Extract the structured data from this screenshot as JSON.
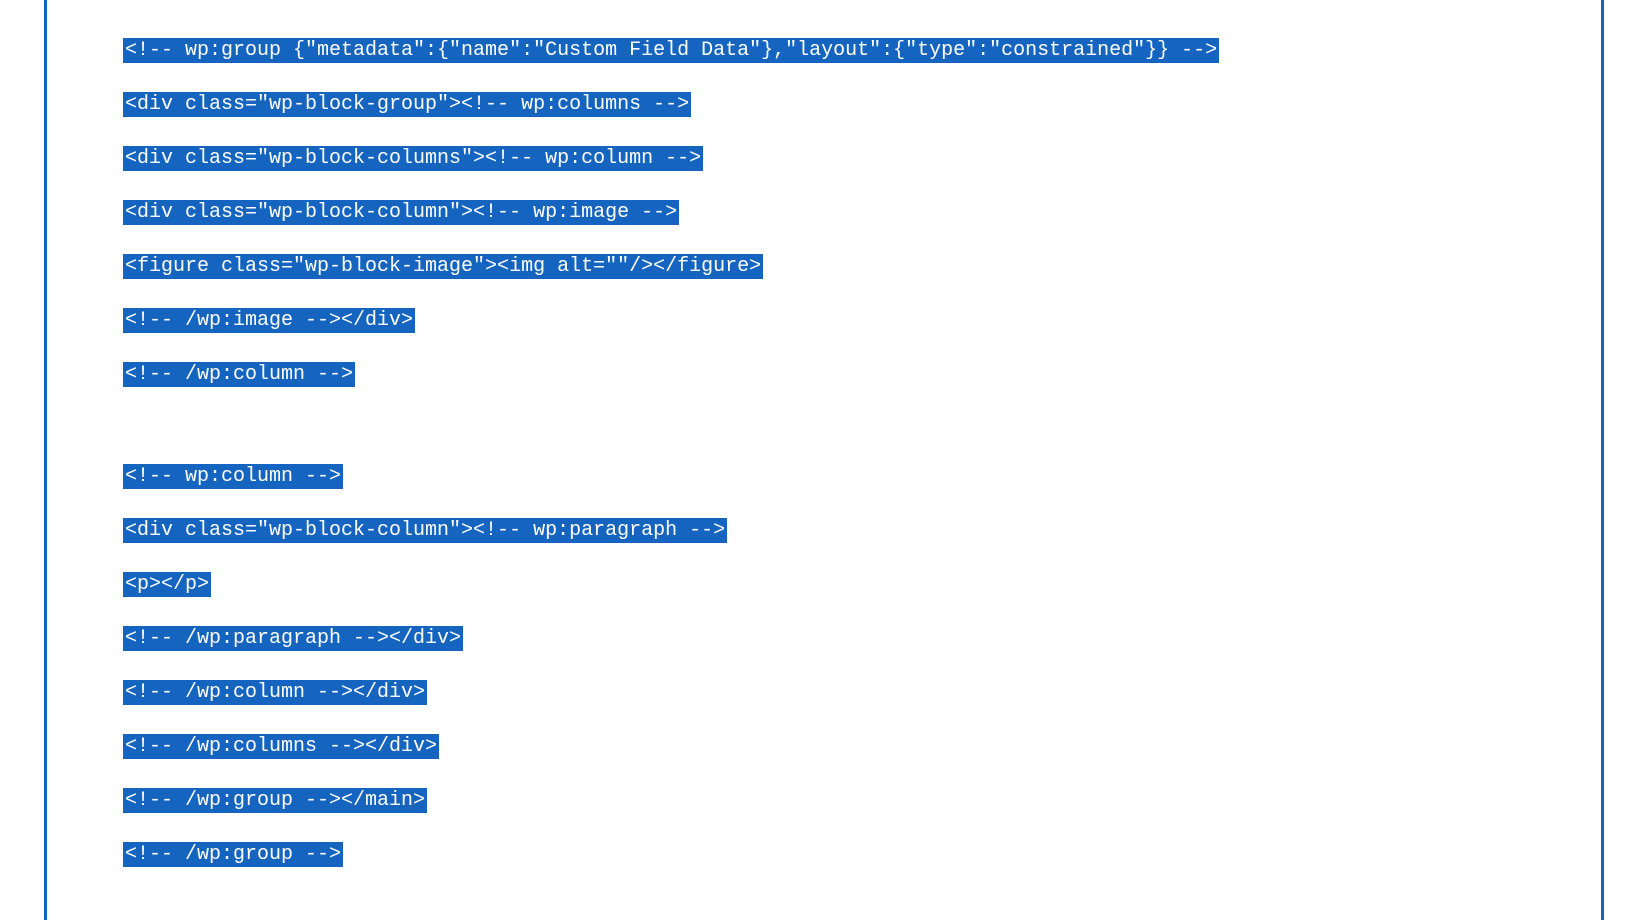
{
  "code_lines": [
    "<!-- wp:group {\"metadata\":{\"name\":\"Custom Field Data\"},\"layout\":{\"type\":\"constrained\"}} -->",
    "<div class=\"wp-block-group\"><!-- wp:columns -->",
    "<div class=\"wp-block-columns\"><!-- wp:column -->",
    "<div class=\"wp-block-column\"><!-- wp:image -->",
    "<figure class=\"wp-block-image\"><img alt=\"\"/></figure>",
    "<!-- /wp:image --></div>",
    "<!-- /wp:column -->",
    "",
    "<!-- wp:column -->",
    "<div class=\"wp-block-column\"><!-- wp:paragraph -->",
    "<p></p>",
    "<!-- /wp:paragraph --></div>",
    "<!-- /wp:column --></div>",
    "<!-- /wp:columns --></div>",
    "<!-- /wp:group --></main>",
    "<!-- /wp:group -->"
  ]
}
